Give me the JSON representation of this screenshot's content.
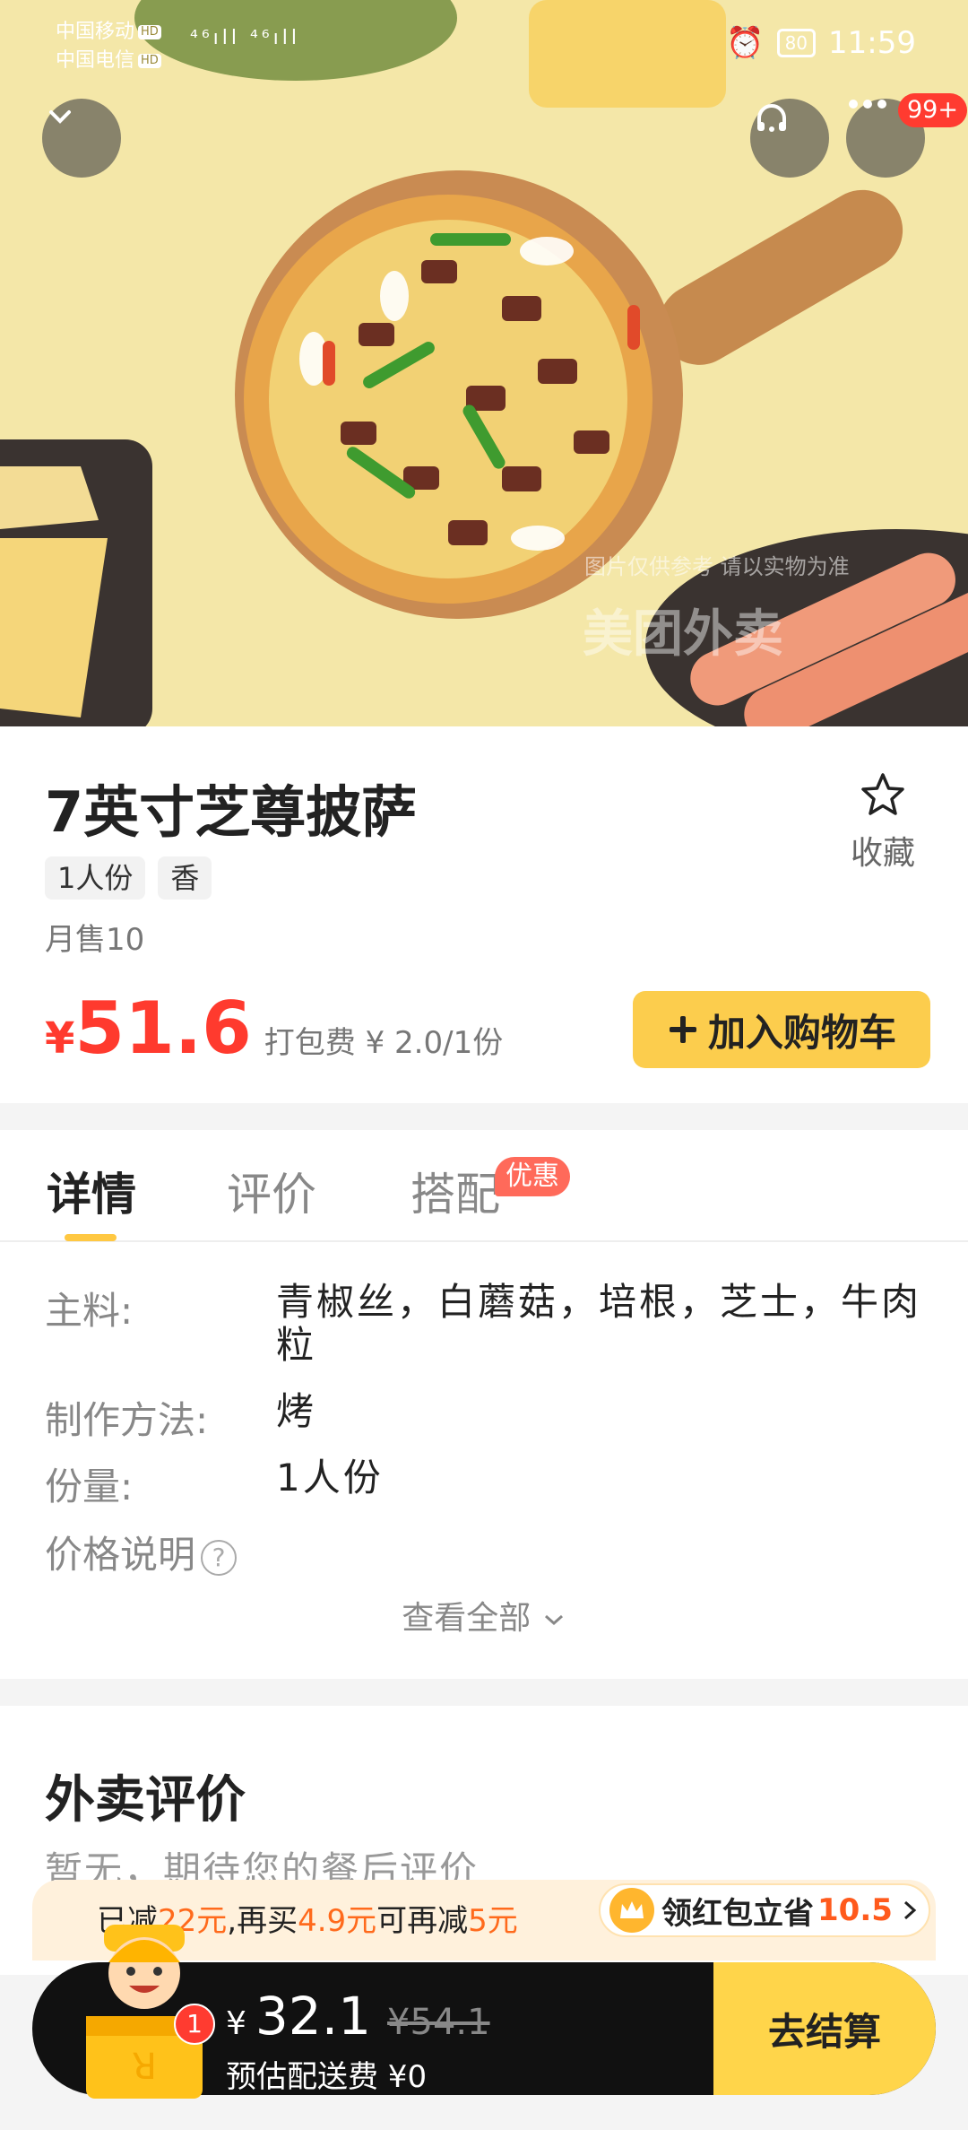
{
  "status_bar": {
    "carrier1": "中国移动",
    "carrier2": "中国电信",
    "hd": "HD",
    "signal": "⁴⁶ıll ⁴⁶ıll",
    "battery": "80",
    "time": "11:59"
  },
  "hero": {
    "badge_count": "99+",
    "watermark_note": "图片仅供参考 请以实物为准",
    "watermark_brand": "美团外卖"
  },
  "product": {
    "name": "7英寸芝尊披萨",
    "tags": [
      "1人份",
      "香"
    ],
    "favorite_label": "收藏",
    "monthly_sales": "月售10",
    "price_symbol": "¥",
    "price": "51.6",
    "packing_fee": "打包费 ¥ 2.0/1份",
    "add_to_cart_label": "加入购物车"
  },
  "tabs": [
    {
      "label": "详情",
      "active": true
    },
    {
      "label": "评价",
      "active": false
    },
    {
      "label": "搭配",
      "active": false
    }
  ],
  "tab_badge": "优惠",
  "details": {
    "ingredients_label": "主料:",
    "ingredients": "青椒丝，白蘑菇，培根，芝士，牛肉粒",
    "method_label": "制作方法:",
    "method": "烤",
    "portion_label": "份量:",
    "portion": "1人份",
    "price_note_label": "价格说明",
    "help_mark": "?",
    "view_all": "查看全部"
  },
  "reviews": {
    "title": "外卖评价",
    "empty_text": "暂无，期待您的餐后评价"
  },
  "discount": {
    "p1": "已减",
    "v1": "22元",
    "p2": ",再买",
    "v2": "4.9元",
    "p3": "可再减",
    "v3": "5元",
    "redpack_label": "领红包立省",
    "redpack_amount": "10.5"
  },
  "cart": {
    "count": "1",
    "symbol": "¥",
    "total": "32.1",
    "original": "¥54.1",
    "delivery": "预估配送费 ¥0",
    "checkout_label": "去结算"
  },
  "colors": {
    "accent_yellow": "#fccd4d",
    "price_red": "#ff3a2e",
    "discount_orange": "#ff6a1c"
  }
}
